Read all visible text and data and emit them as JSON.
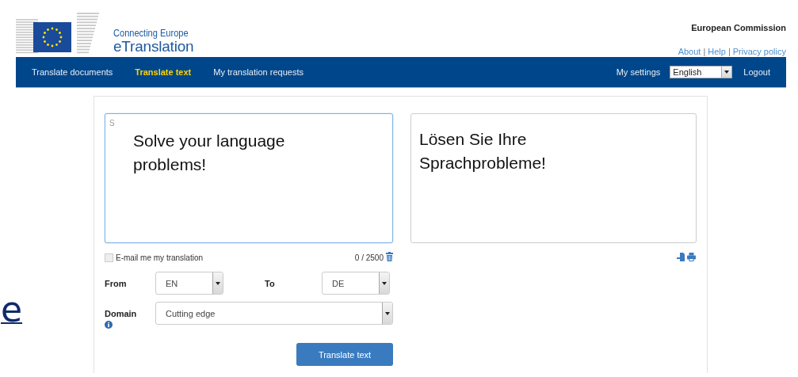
{
  "header": {
    "logo_line1": "Connecting Europe",
    "logo_line2": "eTranslation",
    "organisation": "European Commission",
    "links": [
      "About",
      "Help",
      "Privacy policy"
    ],
    "link_separator": "|"
  },
  "nav": {
    "items": [
      {
        "label": "Translate documents",
        "selected": false
      },
      {
        "label": "Translate text",
        "selected": true
      },
      {
        "label": "My translation requests",
        "selected": false
      }
    ],
    "settings": "My settings",
    "language": "English",
    "logout": "Logout"
  },
  "slide_fragment": "e",
  "source": {
    "value": "S",
    "caption": "Solve your language problems!"
  },
  "target": {
    "caption": "Lösen Sie Ihre Sprachprobleme!"
  },
  "email": {
    "label": "E-mail me my translation",
    "checked": false
  },
  "counter": "0 / 2500",
  "from": {
    "label": "From",
    "value": "EN"
  },
  "to": {
    "label": "To",
    "value": "DE"
  },
  "domain": {
    "label": "Domain",
    "value": "Cutting edge"
  },
  "button": "Translate text"
}
